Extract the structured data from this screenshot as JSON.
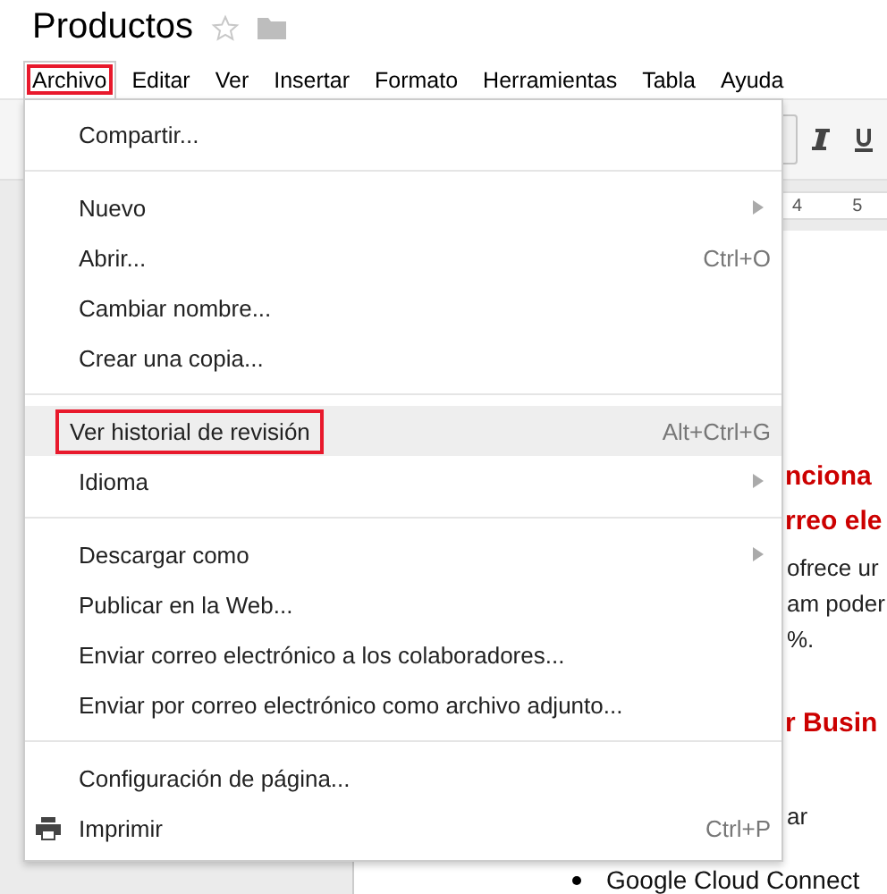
{
  "document_title": "Productos",
  "menubar": [
    {
      "label": "Archivo",
      "selected": true,
      "outlined": true
    },
    {
      "label": "Editar",
      "selected": false,
      "outlined": false
    },
    {
      "label": "Ver",
      "selected": false,
      "outlined": false
    },
    {
      "label": "Insertar",
      "selected": false,
      "outlined": false
    },
    {
      "label": "Formato",
      "selected": false,
      "outlined": false
    },
    {
      "label": "Herramientas",
      "selected": false,
      "outlined": false
    },
    {
      "label": "Tabla",
      "selected": false,
      "outlined": false
    },
    {
      "label": "Ayuda",
      "selected": false,
      "outlined": false
    }
  ],
  "ruler": [
    "4",
    "5"
  ],
  "document": {
    "sections": [
      {
        "heading": [
          "nciona",
          "rreo ele"
        ],
        "body": [
          "ofrece ur",
          "am poder",
          "%."
        ]
      },
      {
        "heading": [
          "r Busin"
        ],
        "body": [
          "ar"
        ],
        "list": [
          "Google Cloud Connect"
        ]
      }
    ]
  },
  "file_menu": [
    {
      "kind": "item",
      "label": "Compartir...",
      "selected": false,
      "outlined": false
    },
    {
      "kind": "separator"
    },
    {
      "kind": "submenu",
      "label": "Nuevo",
      "selected": false,
      "outlined": false
    },
    {
      "kind": "item",
      "label": "Abrir...",
      "shortcut": "Ctrl+O",
      "selected": false,
      "outlined": false
    },
    {
      "kind": "item",
      "label": "Cambiar nombre...",
      "selected": false,
      "outlined": false
    },
    {
      "kind": "item",
      "label": "Crear una copia...",
      "selected": false,
      "outlined": false
    },
    {
      "kind": "separator"
    },
    {
      "kind": "item",
      "label": "Ver historial de revisión",
      "shortcut": "Alt+Ctrl+G",
      "selected": true,
      "outlined": true
    },
    {
      "kind": "submenu",
      "label": "Idioma",
      "selected": false,
      "outlined": false
    },
    {
      "kind": "separator"
    },
    {
      "kind": "submenu",
      "label": "Descargar como",
      "selected": false,
      "outlined": false
    },
    {
      "kind": "item",
      "label": "Publicar en la Web...",
      "selected": false,
      "outlined": false
    },
    {
      "kind": "item",
      "label": "Enviar correo electrónico a los colaboradores...",
      "selected": false,
      "outlined": false
    },
    {
      "kind": "item",
      "label": "Enviar por correo electrónico como archivo adjunto...",
      "selected": false,
      "outlined": false
    },
    {
      "kind": "separator"
    },
    {
      "kind": "item",
      "label": "Configuración de página...",
      "selected": false,
      "outlined": false
    },
    {
      "kind": "print",
      "label": "Imprimir",
      "shortcut": "Ctrl+P",
      "selected": false,
      "outlined": false
    }
  ]
}
